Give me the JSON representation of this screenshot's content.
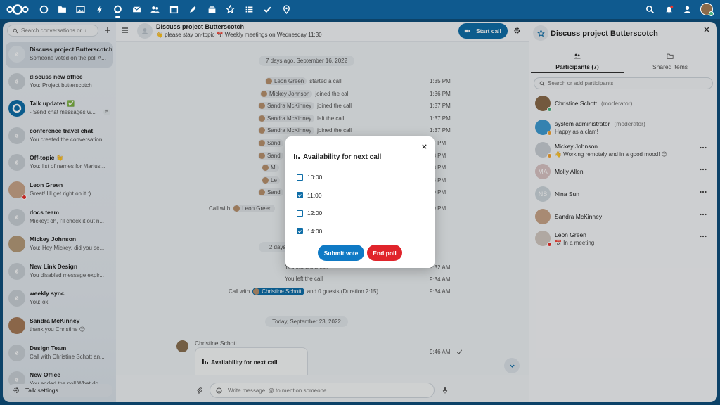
{
  "colors": {
    "header": "#0f5a8f",
    "primary": "#0f6ea8",
    "danger": "#e0242b",
    "background": "#0f4f7c"
  },
  "header": {
    "apps": [
      "dashboard-icon",
      "files-icon",
      "photos-icon",
      "activity-icon",
      "talk-icon",
      "mail-icon",
      "contacts-icon",
      "calendar-icon",
      "notes-icon",
      "deck-icon",
      "starred-icon",
      "tasks-icon",
      "checks-icon",
      "maps-icon"
    ],
    "right_icons": [
      "search-icon",
      "notifications-icon",
      "contacts-menu-icon",
      "user-avatar"
    ]
  },
  "left": {
    "search_placeholder": "Search conversations or u...",
    "conversations": [
      {
        "title": "Discuss project Butterscotch",
        "subtitle": "Someone voted on the poll A...",
        "active": true
      },
      {
        "title": "discuss new office",
        "subtitle": "You: Project butterscotch"
      },
      {
        "title": "Talk updates ✅",
        "subtitle": "- Send chat messages w...",
        "badge": "5"
      },
      {
        "title": "conference travel chat",
        "subtitle": "You created the conversation"
      },
      {
        "title": "Off-topic 👋",
        "subtitle": "You: list of names for Marius..."
      },
      {
        "title": "Leon Green",
        "subtitle": "Great! I'll get right on it :)"
      },
      {
        "title": "docs team",
        "subtitle": "Mickey: oh, I'll check it out n..."
      },
      {
        "title": "Mickey Johnson",
        "subtitle": "You: Hey Mickey, did you se..."
      },
      {
        "title": "New Link Design",
        "subtitle": "You disabled message expir..."
      },
      {
        "title": "weekly sync",
        "subtitle": "You: ok"
      },
      {
        "title": "Sandra McKinney",
        "subtitle": "thank you Christine 😊"
      },
      {
        "title": "Design Team",
        "subtitle": "Call with Christine Schott an..."
      },
      {
        "title": "New Office",
        "subtitle": "You ended the poll What do..."
      }
    ],
    "talk_settings": "Talk settings"
  },
  "chat": {
    "title": "Discuss project Butterscotch",
    "subtitle": "👋 please stay on-topic 📅 Weekly meetings on Wednesday 11:30",
    "start_call": "Start call",
    "date1": "7 days ago, September 16, 2022",
    "events1": [
      {
        "person": "Leon Green",
        "text": "started a call",
        "time": "1:35 PM"
      },
      {
        "person": "Mickey Johnson",
        "text": "joined the call",
        "time": "1:36 PM"
      },
      {
        "person": "Sandra McKinney",
        "text": "joined the call",
        "time": "1:37 PM"
      },
      {
        "person": "Sandra McKinney",
        "text": "left the call",
        "time": "1:37 PM"
      },
      {
        "person": "Sandra McKinney",
        "text": "joined the call",
        "time": "1:37 PM"
      },
      {
        "person": "Sand",
        "text": "",
        "time": "37 PM"
      },
      {
        "person": "Sand",
        "text": "",
        "time": "38 PM"
      },
      {
        "person": "Mi",
        "text": "",
        "time": "38 PM"
      },
      {
        "person": "Le",
        "text": "",
        "time": "38 PM"
      },
      {
        "person": "Sand",
        "text": "",
        "time": "39 PM"
      }
    ],
    "call_summary1_prefix": "Call with",
    "call_summary1_person": "Leon Green",
    "call_summary1_time": "39 PM",
    "date2": "2 days a",
    "events2": [
      {
        "text": "You started a call",
        "time": "9:32 AM"
      },
      {
        "text": "You left the call",
        "time": "9:34 AM"
      }
    ],
    "call_summary2_prefix": "Call with",
    "call_summary2_person": "Christine Schott",
    "call_summary2_suffix": "and 0 guests (Duration 2:15)",
    "call_summary2_time": "9:34 AM",
    "date3": "Today, September 23, 2022",
    "message_author": "Christine Schott",
    "message_time": "9:46 AM",
    "poll_card_title": "Availability for next call",
    "composer_placeholder": "Write message, @ to mention someone ..."
  },
  "right": {
    "title": "Discuss project Butterscotch",
    "tab_participants": "Participants (7)",
    "tab_shared": "Shared items",
    "search_placeholder": "Search or add participants",
    "participants": [
      {
        "name": "Christine Schott",
        "role": "(moderator)",
        "status": "",
        "initials": "",
        "color": "#8a6a4a",
        "stat": "#49b382"
      },
      {
        "name": "system administrator",
        "role": "(moderator)",
        "status": "Happy as a clam!",
        "initials": "",
        "color": "#3f9bd2",
        "stat": "#f4a331"
      },
      {
        "name": "Mickey Johnson",
        "role": "",
        "status": "👋 Working remotely and in a good mood! 😊",
        "initials": "",
        "color": "#c9cfd4",
        "stat": "#f4a331"
      },
      {
        "name": "Molly Allen",
        "role": "",
        "status": "",
        "initials": "MA",
        "color": "#d9c4c4"
      },
      {
        "name": "Nina Sun",
        "role": "",
        "status": "",
        "initials": "NS",
        "color": "#ccd6dc"
      },
      {
        "name": "Sandra McKinney",
        "role": "",
        "status": "",
        "initials": "",
        "color": "#c9a58a"
      },
      {
        "name": "Leon Green",
        "role": "",
        "status": "📅 In a meeting",
        "initials": "",
        "color": "#d2c9c2",
        "stat": "#e9322d"
      }
    ]
  },
  "modal": {
    "title": "Availability for next call",
    "options": [
      {
        "label": "10:00",
        "checked": false
      },
      {
        "label": "11:00",
        "checked": true
      },
      {
        "label": "12:00",
        "checked": false
      },
      {
        "label": "14:00",
        "checked": true
      }
    ],
    "submit": "Submit vote",
    "end": "End poll"
  }
}
